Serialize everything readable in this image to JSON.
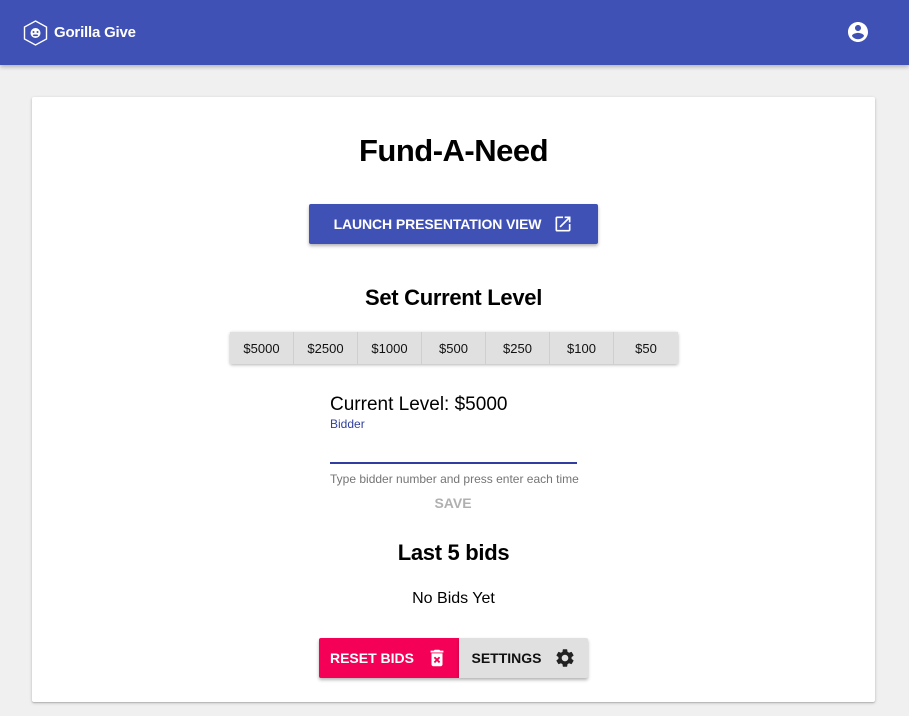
{
  "app": {
    "name": "Gorilla Give",
    "brand_color": "#3f51b5",
    "logo_icon": "gorilla-logo-icon",
    "account_icon": "account-circle-icon"
  },
  "page": {
    "title": "Fund-A-Need",
    "launch_button_label": "LAUNCH PRESENTATION VIEW",
    "launch_icon": "open-in-new-icon",
    "set_level_title": "Set Current Level",
    "levels": [
      "$5000",
      "$2500",
      "$1000",
      "$500",
      "$250",
      "$100",
      "$50"
    ],
    "current_level_text": "Current Level: $5000",
    "bidder": {
      "label": "Bidder",
      "value": "",
      "helper": "Type bidder number and press enter each time"
    },
    "save_label": "SAVE",
    "bids_title": "Last 5 bids",
    "no_bids_text": "No Bids Yet",
    "reset_label": "RESET BIDS",
    "reset_icon": "delete-forever-icon",
    "reset_color": "#f50057",
    "settings_label": "SETTINGS",
    "settings_icon": "gear-icon"
  }
}
